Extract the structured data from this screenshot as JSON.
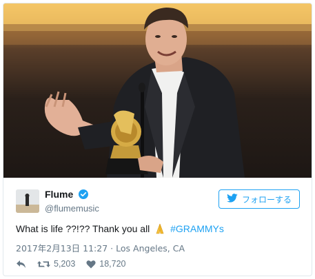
{
  "tweet": {
    "display_name": "Flume",
    "handle": "@flumemusic",
    "follow_label": "フォローする",
    "text_main": "What is life ??!?? Thank you all",
    "hashtag": "#GRAMMYs",
    "date": "2017年2月13日 11:27",
    "location_separator": "·",
    "location": "Los Angeles, CA",
    "retweet_count": "5,203",
    "like_count": "18,720"
  },
  "icons": {
    "verified": "verified-badge-icon",
    "twitter_bird": "twitter-bird-icon",
    "emoji": "folded-hands-emoji",
    "reply": "reply-icon",
    "retweet": "retweet-icon",
    "like": "heart-icon"
  },
  "colors": {
    "accent": "#1da1f2",
    "secondary_text": "#657786",
    "primary_text": "#14171a"
  }
}
